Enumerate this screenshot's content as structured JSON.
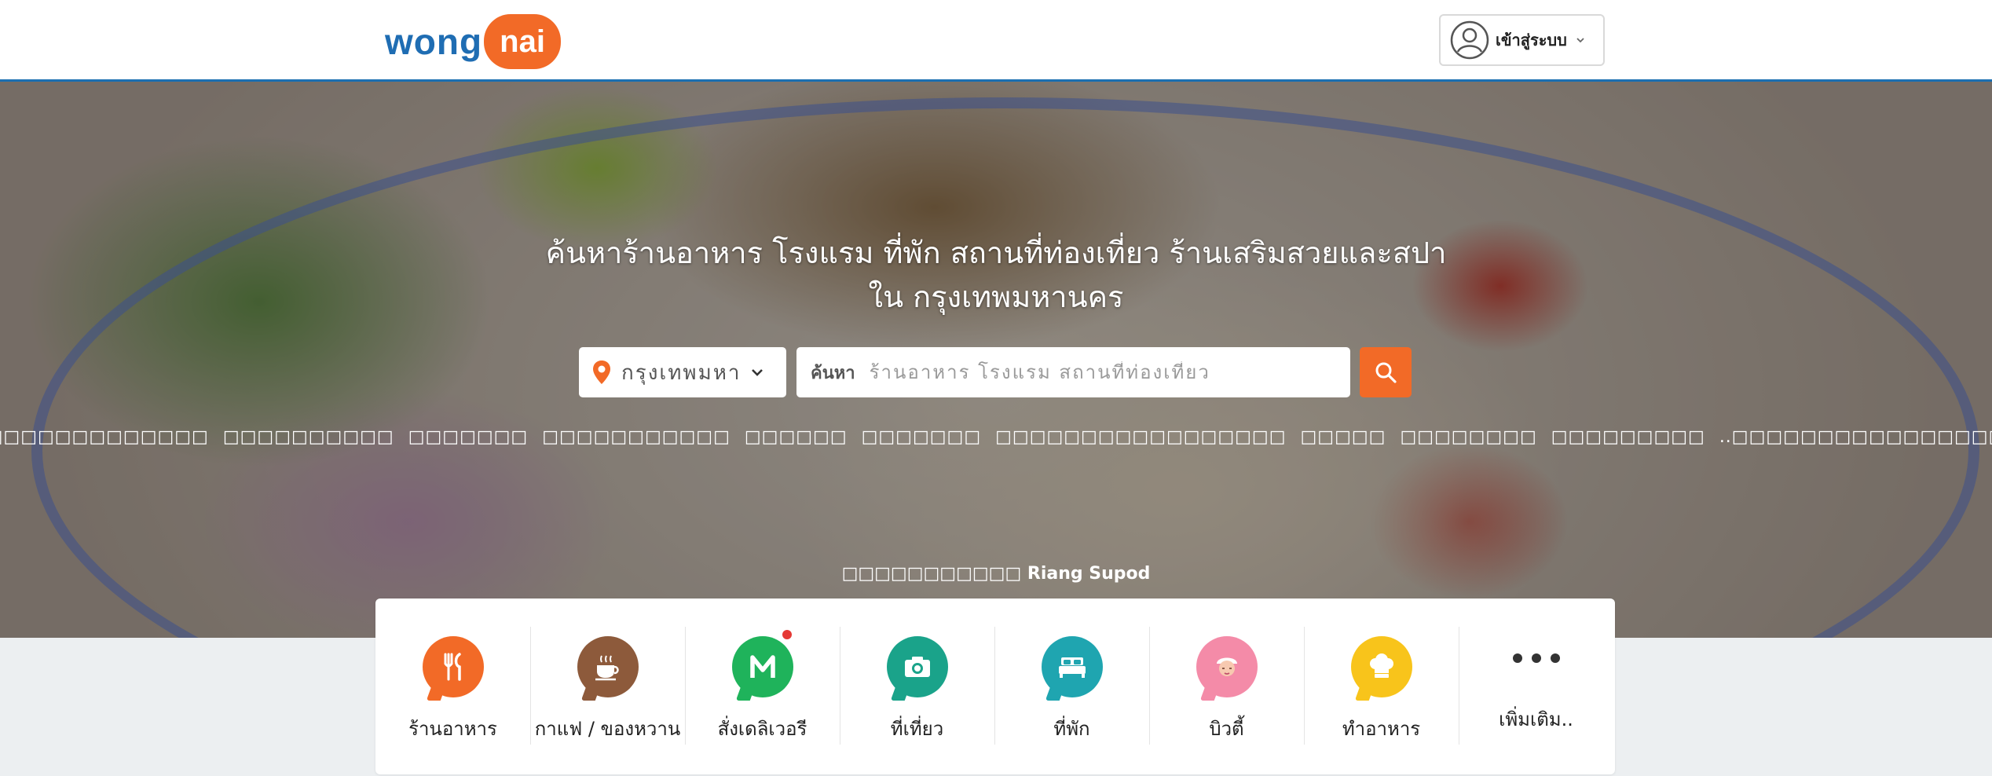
{
  "header": {
    "logo_wong": "wong",
    "logo_nai": "nai",
    "login_label": "เข้าสู่ระบบ",
    "icons": {
      "user": "user-circle-icon",
      "chevron": "chevron-down-icon"
    }
  },
  "hero": {
    "title_line1": "ค้นหาร้านอาหาร โรงแรม ที่พัก สถานที่ท่องเที่ยว ร้านเสริมสวยและสปา",
    "title_line2": "ใน กรุงเทพมหานคร",
    "location_value": "กรุงเทพมหานคร",
    "search_prefix": "ค้นหา",
    "search_placeholder": "ร้านอาหาร โรงแรม สถานที่ท่องเที่ยว",
    "popular_searches": [
      "□□□□□□□□□□□□□□□",
      "□□□□□□□□□□",
      "□□□□□□□",
      "□□□□□□□□□□□",
      "□□□□□□",
      "□□□□□□□",
      "□□□□□□□□□□□□□□□□□",
      "□□□□□",
      "□□□□□□□□",
      "□□□□□□□□□",
      "..□□□□□□□□□□□□□□□□□□"
    ],
    "photo_credit_prefix": "□□□□□□□□□□□",
    "photo_credit_name": "Riang Supod",
    "icons": {
      "location": "location-pin-icon",
      "chevron": "chevron-down-icon",
      "search": "search-icon"
    }
  },
  "categories": [
    {
      "label": "ร้านอาหาร",
      "icon": "fork-knife-icon",
      "color": "#f26a27"
    },
    {
      "label": "กาแฟ / ของหวาน",
      "icon": "coffee-cup-icon",
      "color": "#8d5a3b"
    },
    {
      "label": "สั่งเดลิเวอรี",
      "icon": "delivery-m-icon",
      "color": "#1fb35b",
      "badge": true
    },
    {
      "label": "ที่เที่ยว",
      "icon": "camera-icon",
      "color": "#1aa38a"
    },
    {
      "label": "ที่พัก",
      "icon": "bed-icon",
      "color": "#1fa5b0"
    },
    {
      "label": "บิวตี้",
      "icon": "beauty-face-icon",
      "color": "#f48ba8"
    },
    {
      "label": "ทำอาหาร",
      "icon": "chef-hat-icon",
      "color": "#f8c41b"
    },
    {
      "label": "เพิ่มเติม..",
      "icon": "more-dots-icon",
      "color": "#333333"
    }
  ]
}
